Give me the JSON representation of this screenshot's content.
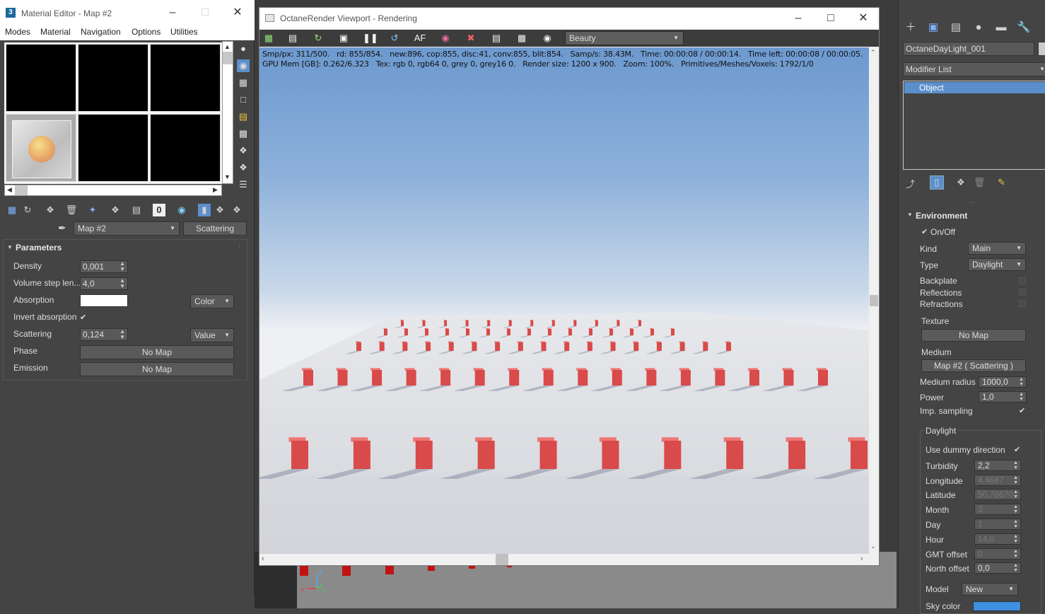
{
  "material_editor": {
    "title": "Material Editor - Map #2",
    "menu": [
      "Modes",
      "Material",
      "Navigation",
      "Options",
      "Utilities"
    ],
    "map_name": "Map #2",
    "map_type_button": "Scattering",
    "params": {
      "title": "Parameters",
      "density_label": "Density",
      "density_value": "0,001",
      "volume_step_label": "Volume step len...",
      "volume_step_value": "4,0",
      "absorption_label": "Absorption",
      "absorption_mode": "Color",
      "invert_absorption_label": "Invert absorption",
      "scattering_label": "Scattering",
      "scattering_value": "0,124",
      "scattering_mode": "Value",
      "phase_label": "Phase",
      "phase_button": "No Map",
      "emission_label": "Emission",
      "emission_button": "No Map"
    }
  },
  "octane_viewport": {
    "title": "OctaneRender Viewport - Rendering",
    "pass": "Beauty",
    "stats_line1": "Smp/px: 311/500.   rd: 855/854.   new:896, cop:855, disc:41, conv:855, blit:854.   Samp/s: 38.43M.   Time: 00:00:08 / 00:00:14.   Time left: 00:00:08 / 00:00:05.",
    "stats_line2": "GPU Mem [GB]: 0.262/6.323   Tex: rgb 0, rgb64 0, grey 0, grey16 0.   Render size: 1200 x 900.   Zoom: 100%.   Primitives/Meshes/Voxels: 1792/1/0"
  },
  "command_panel": {
    "object_name": "OctaneDayLight_001",
    "modifier_list": "Modifier List",
    "stack_item": "Object",
    "environment": {
      "title": "Environment",
      "onoff_label": "On/Off",
      "kind_label": "Kind",
      "kind_value": "Main",
      "type_label": "Type",
      "type_value": "Daylight",
      "backplate_label": "Backplate",
      "reflections_label": "Reflections",
      "refractions_label": "Refractions",
      "texture_label": "Texture",
      "texture_button": "No Map",
      "medium_label": "Medium",
      "medium_button": "Map #2  ( Scattering )",
      "medium_radius_label": "Medium radius",
      "medium_radius_value": "1000,0",
      "power_label": "Power",
      "power_value": "1,0",
      "imp_sampling_label": "Imp. sampling"
    },
    "daylight": {
      "title": "Daylight",
      "use_dummy_label": "Use dummy direction",
      "turbidity_label": "Turbidity",
      "turbidity_value": "2,2",
      "longitude_label": "Longitude",
      "longitude_value": "4,4667",
      "latitude_label": "Latitude",
      "latitude_value": "50,76670",
      "month_label": "Month",
      "month_value": "3",
      "day_label": "Day",
      "day_value": "1",
      "hour_label": "Hour",
      "hour_value": "14,0",
      "gmt_label": "GMT offset",
      "gmt_value": "0",
      "north_label": "North offset",
      "north_value": "0,0",
      "model_label": "Model",
      "model_value": "New",
      "sky_color_label": "Sky color"
    }
  },
  "colors": {
    "accent": "#5b8fcc",
    "panel": "#444444",
    "box_red": "#d94a4a",
    "sky_color": "#3d8fe0"
  }
}
